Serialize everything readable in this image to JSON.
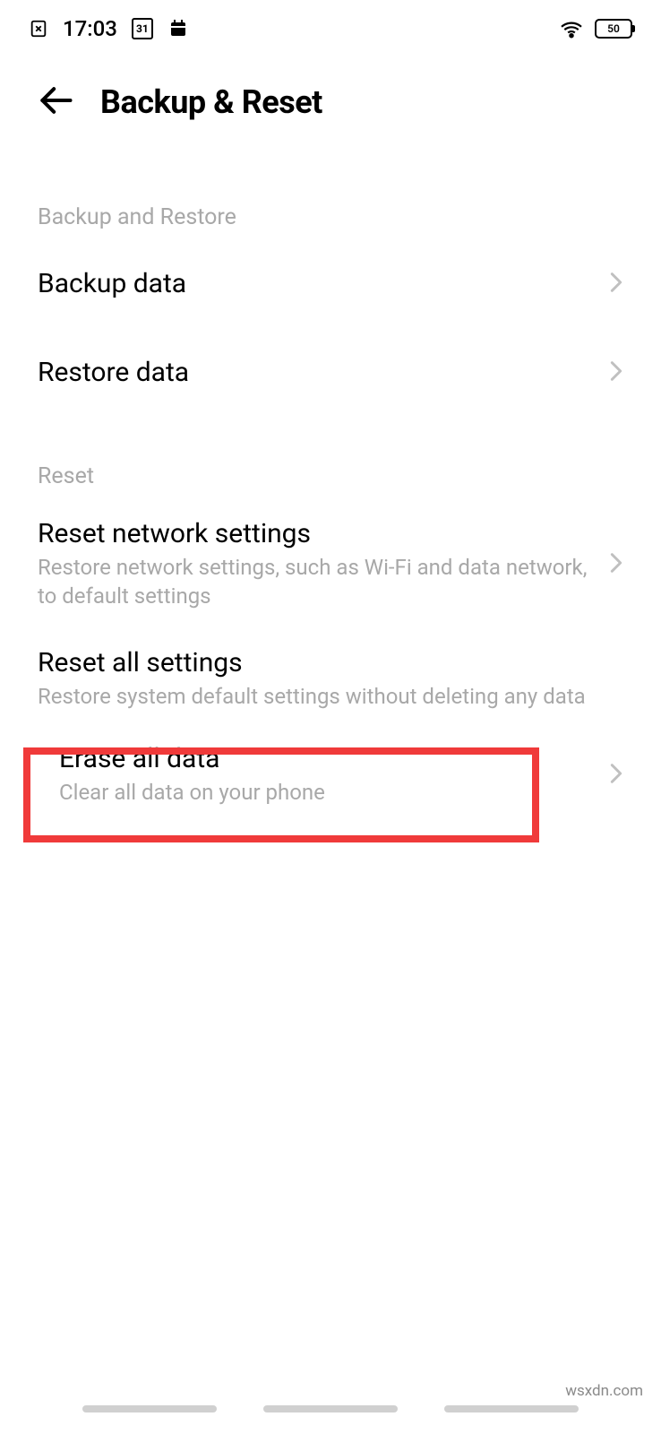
{
  "status": {
    "time": "17:03",
    "calendar_day": "31",
    "battery_label": "50"
  },
  "header": {
    "title": "Backup & Reset"
  },
  "sections": {
    "backup_header": "Backup and Restore",
    "backup_data": {
      "title": "Backup data"
    },
    "restore_data": {
      "title": "Restore data"
    },
    "reset_header": "Reset",
    "reset_network": {
      "title": "Reset network settings",
      "sub": "Restore network settings, such as Wi-Fi and data network, to default settings"
    },
    "reset_all": {
      "title": "Reset all settings",
      "sub": "Restore system default settings without deleting any data"
    },
    "erase_all": {
      "title": "Erase all data",
      "sub": "Clear all data on your phone"
    }
  },
  "watermark": "wsxdn.com"
}
